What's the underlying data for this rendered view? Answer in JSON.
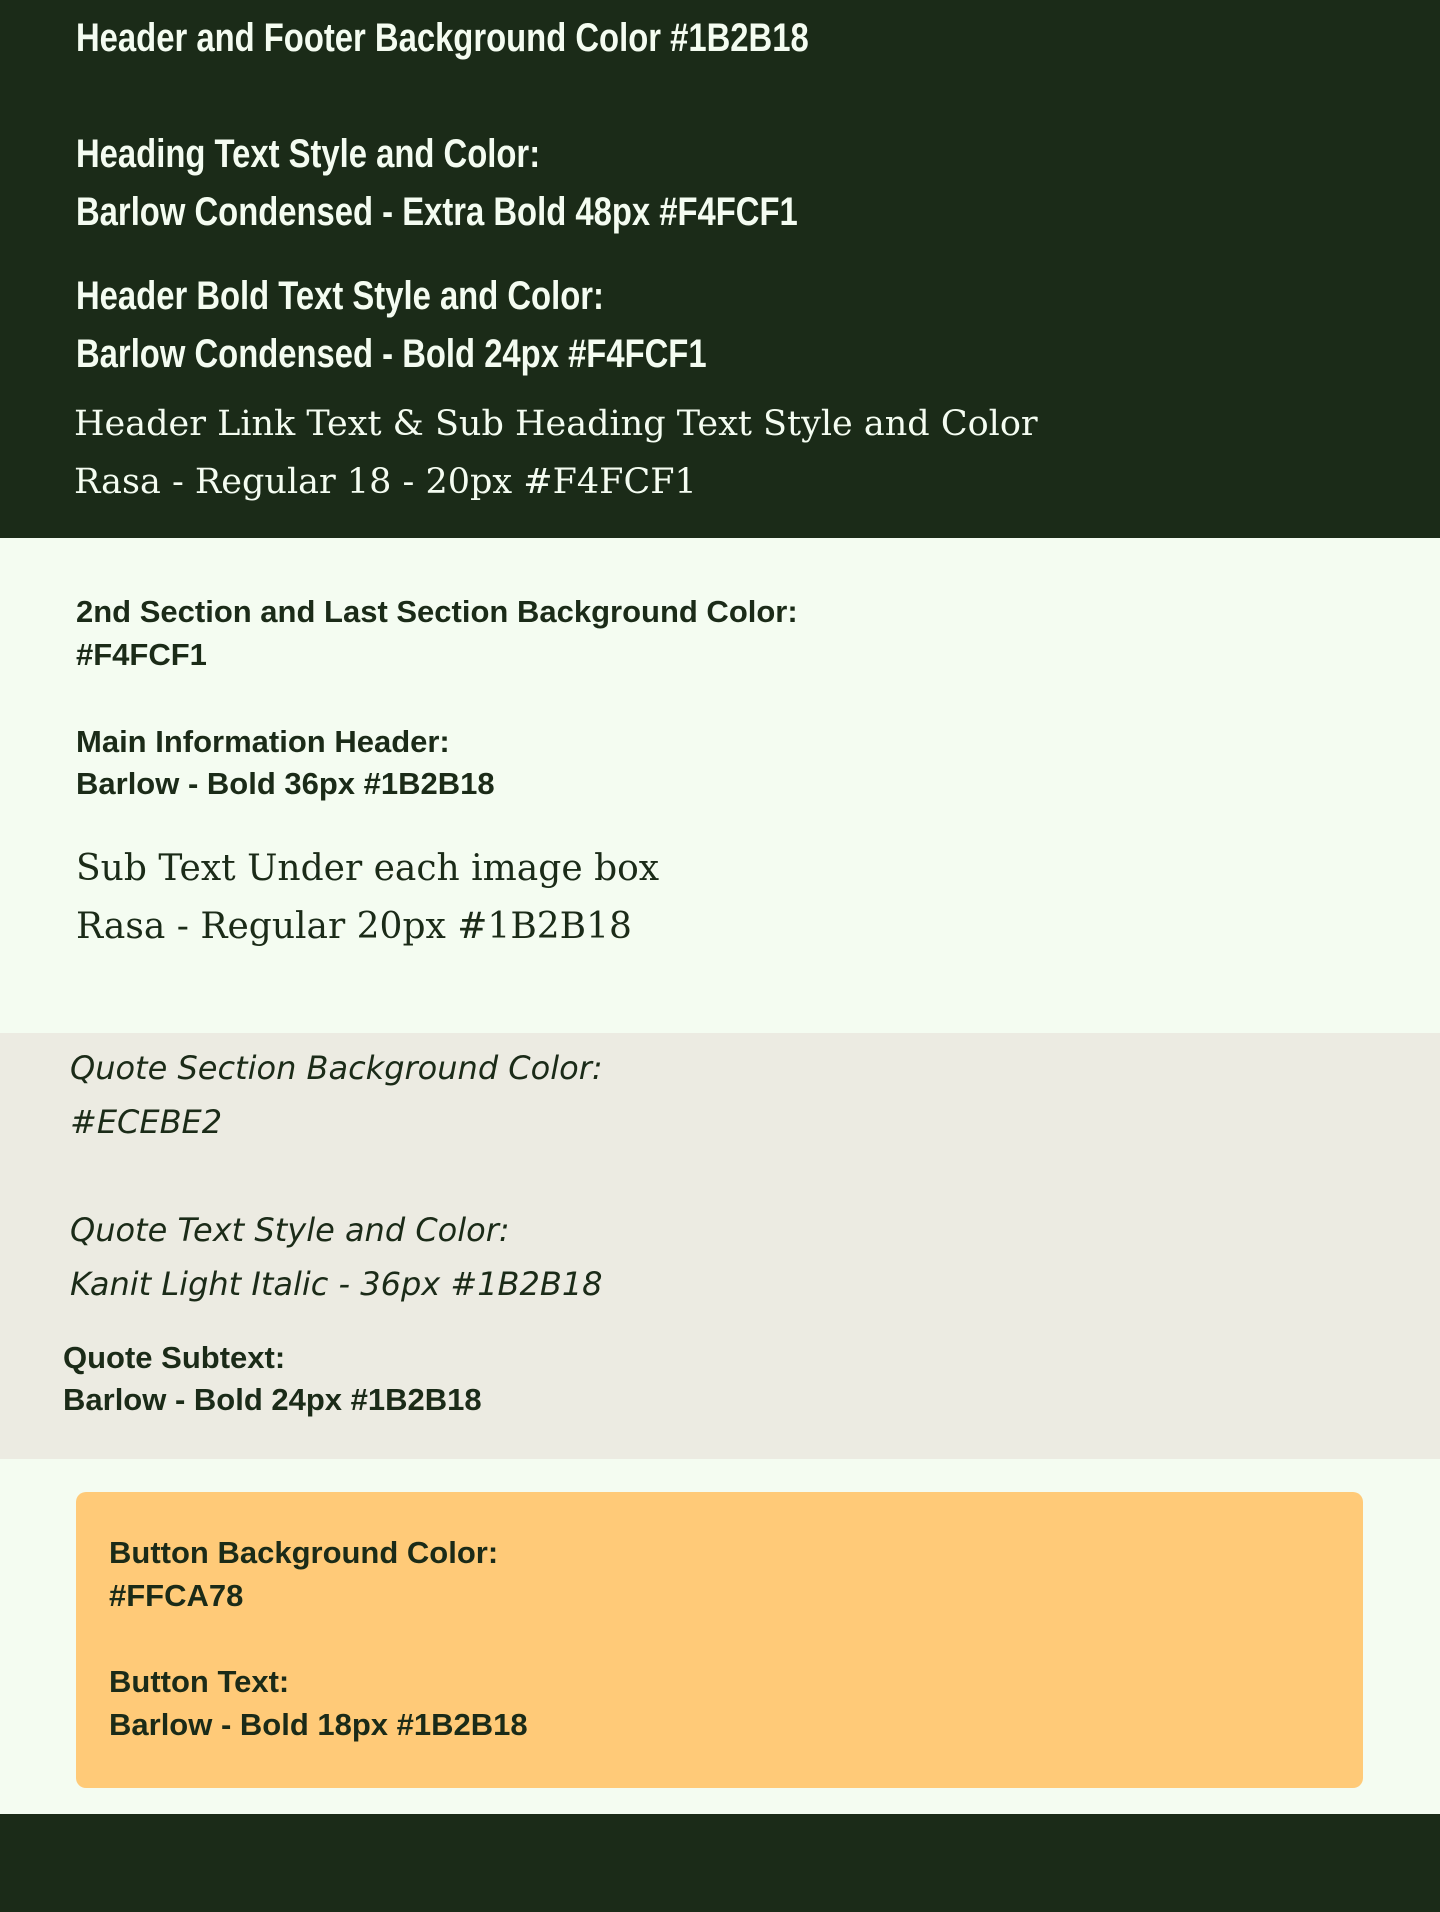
{
  "header": {
    "bg_color": "#1B2B18",
    "line1": "Header and Footer Background Color #1B2B18",
    "heading_style_label": "Heading Text Style and Color:",
    "heading_style_value": "Barlow Condensed - Extra Bold 48px #F4FCF1",
    "bold_style_label": "Header Bold Text Style and Color:",
    "bold_style_value": "Barlow Condensed - Bold 24px #F4FCF1",
    "link_style_label": "Header Link Text & Sub Heading Text Style and Color",
    "link_style_value": "Rasa - Regular 18 - 20px #F4FCF1"
  },
  "section2": {
    "bg_color": "#F4FCF1",
    "bg_label": "2nd Section and Last Section Background Color:",
    "bg_value": "#F4FCF1",
    "main_header_label": "Main Information Header:",
    "main_header_value": "Barlow - Bold 36px #1B2B18",
    "sub_text_label": "Sub Text Under each image box",
    "sub_text_value": "Rasa - Regular 20px #1B2B18"
  },
  "quote": {
    "bg_color": "#ECEBE2",
    "bg_label": "Quote Section Background Color:",
    "bg_value": "#ECEBE2",
    "text_label": "Quote Text Style and Color:",
    "text_value": "Kanit Light Italic - 36px #1B2B18",
    "subtext_label": "Quote Subtext:",
    "subtext_value": "Barlow - Bold 24px #1B2B18"
  },
  "button": {
    "bg_color": "#FFCA78",
    "bg_label": "Button Background Color:",
    "bg_value": "#FFCA78",
    "text_label": "Button Text:",
    "text_value": "Barlow - Bold 18px #1B2B18"
  },
  "footer": {
    "bg_color": "#1B2B18"
  }
}
